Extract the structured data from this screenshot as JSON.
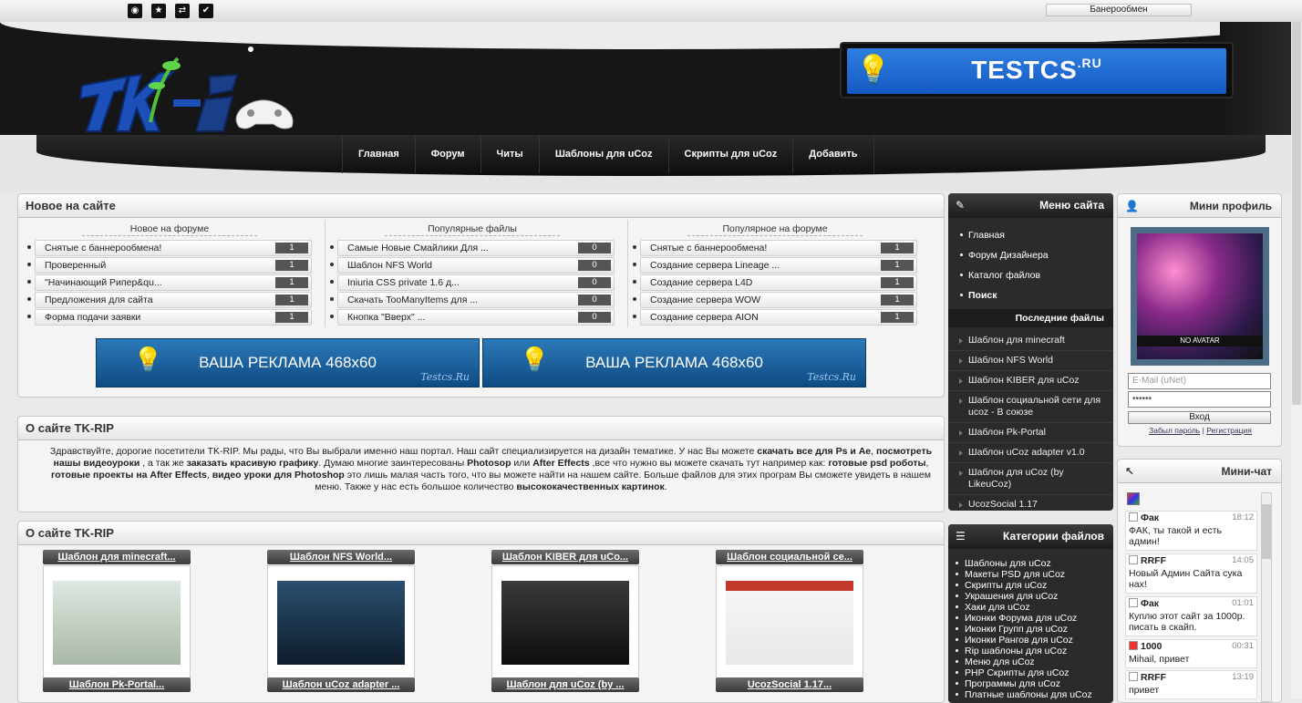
{
  "topbar": {
    "banner_exchange": "Банерообмен",
    "icons": [
      "rss-icon",
      "star-icon",
      "share-icon",
      "check-icon"
    ]
  },
  "header": {
    "ad": {
      "brand": "TESTCS",
      "tld": ".RU"
    }
  },
  "nav": [
    "Главная",
    "Форум",
    "Читы",
    "Шаблоны для uCoz",
    "Скрипты для uCoz",
    "Добавить"
  ],
  "new_panel": {
    "title": "Новое на сайте",
    "columns": [
      {
        "head": "Новое на форуме",
        "rows": [
          {
            "t": "Снятые с баннерообмена!",
            "n": "1"
          },
          {
            "t": "Проверенный",
            "n": "1"
          },
          {
            "t": "\"Начинающий Рипер&qu...",
            "n": "1"
          },
          {
            "t": "Предложения для сайта",
            "n": "1"
          },
          {
            "t": "Форма подачи заявки",
            "n": "1"
          }
        ]
      },
      {
        "head": "Популярные файлы",
        "rows": [
          {
            "t": "Самые Новые Смайлики Для ...",
            "n": "0"
          },
          {
            "t": "Шаблон NFS World",
            "n": "0"
          },
          {
            "t": "Iniuria CSS private 1.6 д...",
            "n": "0"
          },
          {
            "t": "Скачать TooManyItems для ...",
            "n": "0"
          },
          {
            "t": "Кнопка \"Вверх\" ...",
            "n": "0"
          }
        ]
      },
      {
        "head": "Популярное на форуме",
        "rows": [
          {
            "t": "Снятые с баннерообмена!",
            "n": "1"
          },
          {
            "t": "Создание сервера Lineage ...",
            "n": "1"
          },
          {
            "t": "Создание сервера L4D",
            "n": "1"
          },
          {
            "t": "Создание сервера WOW",
            "n": "1"
          },
          {
            "t": "Создание сервера AION",
            "n": "1"
          }
        ]
      }
    ],
    "ads": [
      {
        "text": "ВАША РЕКЛАМА 468x60",
        "sig": "Testcs.Ru"
      },
      {
        "text": "ВАША РЕКЛАМА 468x60",
        "sig": "Testcs.Ru"
      }
    ]
  },
  "about": {
    "title": "О сайте TK-RIP",
    "p1": "Здравствуйте, дорогие посетители TK-RIP. Мы рады, что Вы выбрали именно наш портал. Наш сайт специализируется на дизайн тематике. У нас Вы можете ",
    "b1": "скачать все для  Ps и Ae",
    "p2": ", ",
    "b2": "посмотреть нашы видеоуроки",
    "p3": " , а так же ",
    "b3": "заказать красивую графику",
    "p4": ". Думаю многие заинтересованы ",
    "b4": "Photosop",
    "p5": " или ",
    "b5": "After Effects",
    "p6": " ,все что нужно вы можете скачать тут например как: ",
    "b6": "готовые psd роботы",
    "p7": ", ",
    "b7": "готовые проекты на After Effects",
    "p8": ", ",
    "b8": "видео уроки для Photoshop",
    "p9": " это лишь малая часть того, что вы можете найти на нашем сайте. Больше файлов для этих програм Вы сможете увидеть в нашем меню. Также у нас есть большое количество ",
    "b9": "высококачественных картинок",
    "p10": "."
  },
  "gallery": {
    "title": "О сайте TK-RIP",
    "tiles": [
      "Шаблон для minecraft...",
      "Шаблон NFS World...",
      "Шаблон KIBER для uCo...",
      "Шаблон социальной се...",
      "Шаблон Pk-Portal...",
      "Шаблон uCoz adapter ...",
      "Шаблон для uCoz (by ...",
      "UcozSocial 1.17..."
    ]
  },
  "site_menu": {
    "title": "Меню сайта",
    "items": [
      "Главная",
      "Форум Дизайнера",
      "Каталог файлов",
      "Поиск"
    ],
    "last_files_title": "Последние файлы",
    "files": [
      "Шаблон для minecraft",
      "Шаблон NFS World",
      "Шаблон KIBER для uCoz",
      "Шаблон социальной сети для ucoz - В союзе",
      "Шаблон Pk-Portal",
      "Шаблон uCoz adapter v1.0",
      "Шаблон для uCoz (by LikeuCoz)",
      "UcozSocial 1.17"
    ]
  },
  "categories": {
    "title": "Категории файлов",
    "items": [
      "Шаблоны для uCoz",
      "Макеты PSD для uCoz",
      "Скрипты для uCoz",
      "Украшения для uCoz",
      "Хаки для uCoz",
      "Иконки Форума для uCoz",
      "Иконки Групп для uCoz",
      "Иконки Рангов для uCoz",
      "Rip шаблоны для uCoz",
      "Меню для uCoz",
      "PHP Скрипты для uCoz",
      "Программы для uCoz",
      "Платные шаблоны для uCoz"
    ]
  },
  "mini_profile": {
    "title": "Мини профиль",
    "no_avatar": "NO AVATAR",
    "email_placeholder": "E-Mail (uNet)",
    "password_mask": "••••••",
    "login": "Вход",
    "forgot": "Забыл пароль",
    "sep": "|",
    "register": "Регистрация"
  },
  "mini_chat": {
    "title": "Мини-чат",
    "messages": [
      {
        "user": "Фак",
        "time": "18:12",
        "text": "ФАК, ты такой и есть админ!"
      },
      {
        "user": "RRFF",
        "time": "14:05",
        "text": "Новый Админ Сайта сука нах!"
      },
      {
        "user": "Фак",
        "time": "01:01",
        "text": "Куплю этот сайт за 1000р. писать в скайп."
      },
      {
        "user": "1000",
        "time": "00:31",
        "text": "Mihail, привет"
      },
      {
        "user": "RRFF",
        "time": "13:19",
        "text": "привет"
      }
    ]
  },
  "colors": {
    "accent": "#1559c4",
    "dark": "#161616"
  }
}
